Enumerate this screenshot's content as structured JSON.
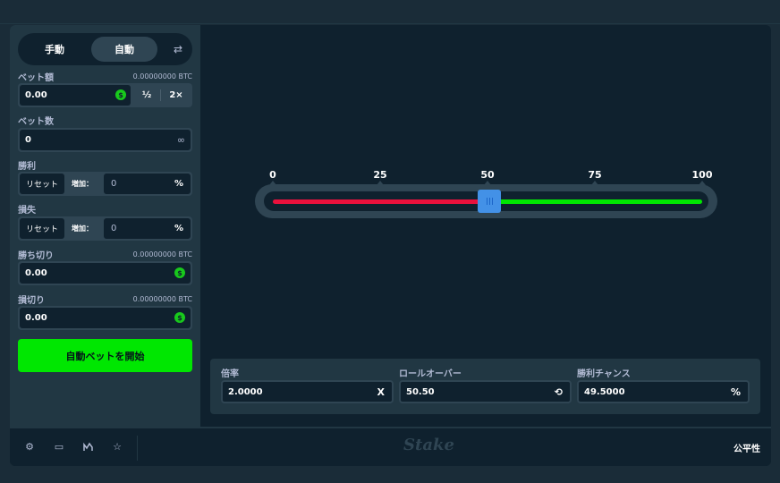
{
  "mode": {
    "manual": "手動",
    "auto": "自動",
    "swap_icon": "swap-icon"
  },
  "bet_amount": {
    "label": "ベット額",
    "btc": "0.00000000 BTC",
    "value": "0.00",
    "half": "½",
    "double": "2×"
  },
  "bet_count": {
    "label": "ベット数",
    "value": "0",
    "icon": "infinity-icon"
  },
  "on_win": {
    "label": "勝利",
    "reset": "リセット",
    "increase": "増加：",
    "value": "0",
    "suffix": "%"
  },
  "on_loss": {
    "label": "損失",
    "reset": "リセット",
    "increase": "増加：",
    "value": "0",
    "suffix": "%"
  },
  "stop_profit": {
    "label": "勝ち切り",
    "btc": "0.00000000 BTC",
    "value": "0.00"
  },
  "stop_loss": {
    "label": "損切り",
    "btc": "0.00000000 BTC",
    "value": "0.00"
  },
  "start_button": "自動ベットを開始",
  "slider": {
    "ticks": [
      "0",
      "25",
      "50",
      "75",
      "100"
    ],
    "value": 50.5,
    "min": 0,
    "max": 100,
    "lose_color": "#e9113c",
    "win_color": "#00e701"
  },
  "stats": {
    "multiplier": {
      "label": "倍率",
      "value": "2.0000",
      "suffix": "X"
    },
    "rollover": {
      "label": "ロールオーバー",
      "value": "50.50",
      "suffix": "⟲"
    },
    "win_chance": {
      "label": "勝利チャンス",
      "value": "49.5000",
      "suffix": "%"
    }
  },
  "footer": {
    "logo": "Stake",
    "fairness": "公平性",
    "icons": [
      "gear-icon",
      "theatre-icon",
      "stats-icon",
      "star-icon"
    ]
  }
}
